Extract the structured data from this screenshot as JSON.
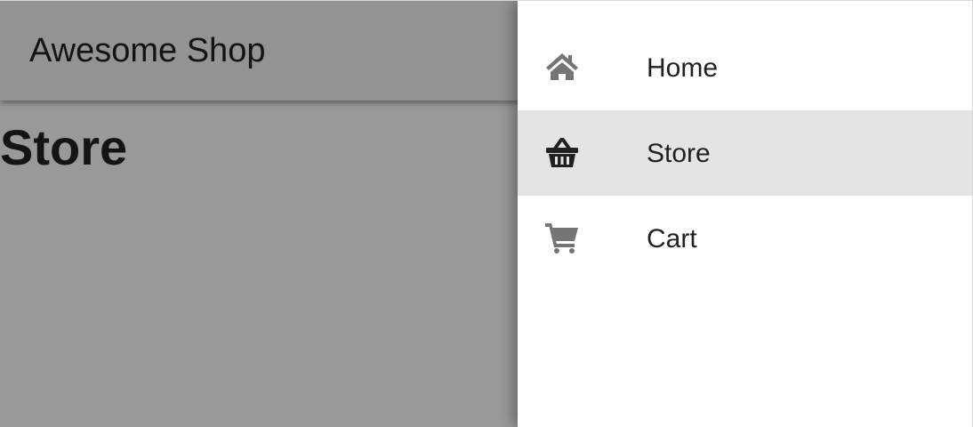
{
  "app": {
    "title": "Awesome Shop"
  },
  "main": {
    "heading": "Store"
  },
  "drawer": {
    "items": [
      {
        "label": "Home",
        "icon": "home-icon",
        "active": false
      },
      {
        "label": "Store",
        "icon": "basket-icon",
        "active": true
      },
      {
        "label": "Cart",
        "icon": "cart-icon",
        "active": false
      }
    ]
  },
  "colors": {
    "active_item_bg": "#e4e4e4",
    "inactive_icon": "#757575",
    "active_icon": "#212121",
    "backdrop": "rgba(0,0,0,0.40)"
  }
}
